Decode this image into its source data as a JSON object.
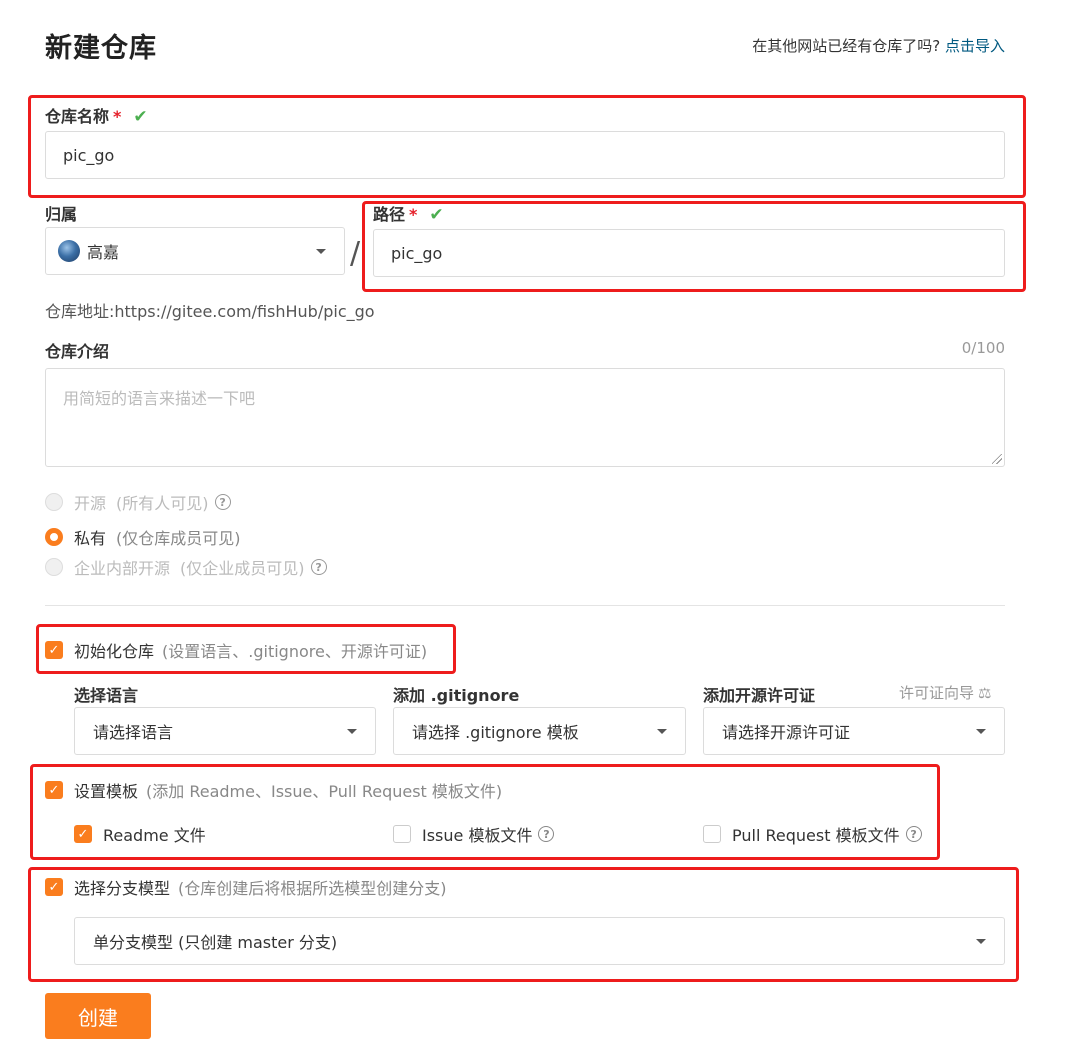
{
  "page": {
    "title": "新建仓库",
    "import_question": "在其他网站已经有仓库了吗?",
    "import_link": "点击导入"
  },
  "repo_name": {
    "label": "仓库名称",
    "required_mark": "*",
    "valid_icon": "check-icon",
    "value": "pic_go"
  },
  "owner": {
    "label": "归属",
    "value": "高嘉",
    "separator": "/"
  },
  "path": {
    "label": "路径",
    "required_mark": "*",
    "valid_icon": "check-icon",
    "value": "pic_go"
  },
  "repo_address": "仓库地址:https://gitee.com/fishHub/pic_go",
  "description": {
    "label": "仓库介绍",
    "counter": "0/100",
    "placeholder": "用简短的语言来描述一下吧"
  },
  "visibility": {
    "options": [
      {
        "label": "开源",
        "hint": "(所有人可见)",
        "selected": false,
        "disabled": true,
        "help": true
      },
      {
        "label": "私有",
        "hint": "(仅仓库成员可见)",
        "selected": true,
        "disabled": false,
        "help": false
      },
      {
        "label": "企业内部开源",
        "hint": "(仅企业成员可见)",
        "selected": false,
        "disabled": true,
        "help": true
      }
    ]
  },
  "init_repo": {
    "label": "初始化仓库",
    "hint": "(设置语言、.gitignore、开源许可证)",
    "checked": true
  },
  "language": {
    "label": "选择语言",
    "value": "请选择语言"
  },
  "gitignore": {
    "label": "添加 .gitignore",
    "value": "请选择 .gitignore 模板"
  },
  "license": {
    "label": "添加开源许可证",
    "guide": "许可证向导",
    "guide_icon": "scale-icon",
    "value": "请选择开源许可证"
  },
  "template": {
    "label": "设置模板",
    "hint": "(添加 Readme、Issue、Pull Request 模板文件)",
    "checked": true,
    "files": [
      {
        "label": "Readme 文件",
        "checked": true
      },
      {
        "label": "Issue 模板文件",
        "checked": false
      },
      {
        "label": "Pull Request 模板文件",
        "checked": false
      }
    ]
  },
  "branch_model": {
    "label": "选择分支模型",
    "hint": "(仓库创建后将根据所选模型创建分支)",
    "checked": true,
    "value": "单分支模型 (只创建 master 分支)"
  },
  "create_button": "创建",
  "colors": {
    "accent": "#fa7d1e",
    "annotation_red": "#ee1c1c",
    "valid_green": "#4caf50",
    "link": "#005980"
  }
}
